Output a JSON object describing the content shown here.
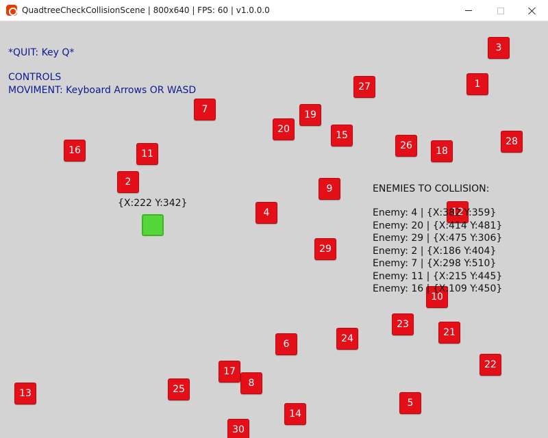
{
  "window": {
    "title": "QuadtreeCheckCollisionScene | 800x640 | FPS: 60 | v1.0.0.0",
    "buttons": {
      "minimize": "minimize",
      "maximize": "maximize",
      "close": "close"
    }
  },
  "hud": {
    "quit": "*QUIT: Key Q*",
    "controls_title": "CONTROLS",
    "controls_movement": "MOVIMENT: Keyboard Arrows OR WASD"
  },
  "player": {
    "coords": "{X:222 Y:342}",
    "color": "#55d63a"
  },
  "enemy_color": "#e3101a",
  "enemies": [
    "1",
    "2",
    "3",
    "4",
    "5",
    "6",
    "7",
    "8",
    "9",
    "10",
    "11",
    "12",
    "13",
    "14",
    "15",
    "16",
    "17",
    "18",
    "19",
    "20",
    "21",
    "22",
    "23",
    "24",
    "25",
    "26",
    "27",
    "28",
    "29",
    "30"
  ],
  "collision_panel": {
    "title": "ENEMIES TO COLLISION:",
    "items": [
      "Enemy: 4 | {X:382 Y:359}",
      "Enemy: 20 | {X:414 Y:481}",
      "Enemy: 29 | {X:475 Y:306}",
      "Enemy: 2 | {X:186 Y:404}",
      "Enemy: 7 | {X:298 Y:510}",
      "Enemy: 11 | {X:215 Y:445}",
      "Enemy: 16 | {X:109 Y:450}"
    ]
  }
}
